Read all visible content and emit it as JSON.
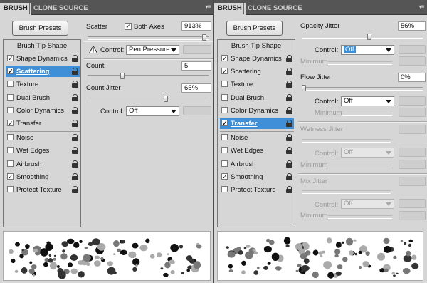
{
  "left": {
    "tabs": {
      "brush": "BRUSH",
      "clone_source": "CLONE SOURCE"
    },
    "brush_presets_label": "Brush Presets",
    "list": {
      "header": "Brush Tip Shape",
      "items": [
        {
          "label": "Shape Dynamics",
          "checked": true
        },
        {
          "label": "Scattering",
          "checked": true,
          "selected": true
        },
        {
          "label": "Texture",
          "checked": false
        },
        {
          "label": "Dual Brush",
          "checked": false
        },
        {
          "label": "Color Dynamics",
          "checked": false
        },
        {
          "label": "Transfer",
          "checked": true
        },
        {
          "label": "Noise",
          "checked": false
        },
        {
          "label": "Wet Edges",
          "checked": false
        },
        {
          "label": "Airbrush",
          "checked": false
        },
        {
          "label": "Smoothing",
          "checked": true
        },
        {
          "label": "Protect Texture",
          "checked": false
        }
      ]
    },
    "scatter": {
      "label": "Scatter",
      "both_axes_label": "Both Axes",
      "both_axes_checked": true,
      "value": "913%",
      "slider_fraction": 0.98
    },
    "control1": {
      "label": "Control:",
      "value": "Pen Pressure"
    },
    "count": {
      "label": "Count",
      "value": "5",
      "slider_fraction": 0.28
    },
    "count_jitter": {
      "label": "Count Jitter",
      "value": "65%",
      "slider_fraction": 0.65
    },
    "control2": {
      "label": "Control:",
      "value": "Off"
    }
  },
  "right": {
    "tabs": {
      "brush": "BRUSH",
      "clone_source": "CLONE SOURCE"
    },
    "brush_presets_label": "Brush Presets",
    "list": {
      "header": "Brush Tip Shape",
      "items": [
        {
          "label": "Shape Dynamics",
          "checked": true
        },
        {
          "label": "Scattering",
          "checked": true
        },
        {
          "label": "Texture",
          "checked": false
        },
        {
          "label": "Dual Brush",
          "checked": false
        },
        {
          "label": "Color Dynamics",
          "checked": false
        },
        {
          "label": "Transfer",
          "checked": true,
          "selected": true
        },
        {
          "label": "Noise",
          "checked": false
        },
        {
          "label": "Wet Edges",
          "checked": false
        },
        {
          "label": "Airbrush",
          "checked": false
        },
        {
          "label": "Smoothing",
          "checked": true
        },
        {
          "label": "Protect Texture",
          "checked": false
        }
      ]
    },
    "opacity_jitter": {
      "label": "Opacity Jitter",
      "value": "56%",
      "slider_fraction": 0.56
    },
    "opacity_control": {
      "label": "Control:",
      "value": "Off"
    },
    "minimum_label": "Minimum",
    "flow_jitter": {
      "label": "Flow Jitter",
      "value": "0%",
      "slider_fraction": 0.0
    },
    "flow_control": {
      "label": "Control:",
      "value": "Off"
    },
    "wetness_jitter": {
      "label": "Wetness Jitter"
    },
    "wetness_control": {
      "label": "Control:",
      "value": "Off"
    },
    "mix_jitter": {
      "label": "Mix Jitter"
    },
    "mix_control": {
      "label": "Control:",
      "value": "Off"
    }
  },
  "icons": [
    "lock-icon",
    "warning-icon",
    "panel-menu-icon",
    "checkmark-icon",
    "dropdown-arrow-icon"
  ],
  "colors": {
    "selection": "#3f8fd8",
    "panel_bg": "#d6d6d6",
    "tab_bar": "#555555"
  }
}
